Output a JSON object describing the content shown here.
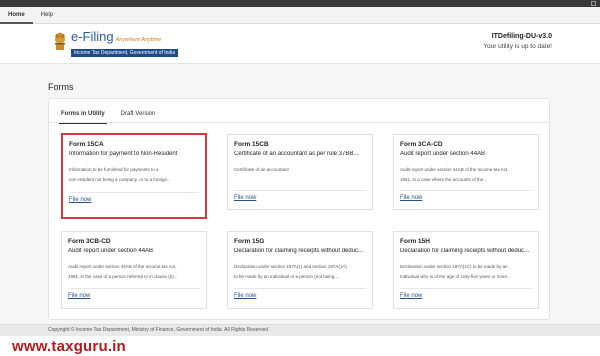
{
  "menu": {
    "items": [
      "Home",
      "Help"
    ]
  },
  "header": {
    "brand": "e-Filing",
    "tagline": "Anywhere Anytime",
    "department": "Income Tax Department, Government of India",
    "version": "ITDefiling-DU-v3.0",
    "status": "Your utility is up to date!"
  },
  "page": {
    "title": "Forms"
  },
  "tabs": [
    "Forms in Utility",
    "Draft Version"
  ],
  "cards": [
    {
      "title": "Form 15CA",
      "subtitle": "Information for payment to Non-Resident",
      "desc1": "Information to be furnished for payments to a",
      "desc2": "non-resident not being a company, or to a foreign...",
      "link": "File now"
    },
    {
      "title": "Form 15CB",
      "subtitle": "Certificate of an accountant as per rule 37BB...",
      "desc1": "Certificate of an accountant",
      "desc2": "",
      "link": "File now"
    },
    {
      "title": "Form 3CA-CD",
      "subtitle": "Audit report under section 44AB",
      "desc1": "Audit report under section 44AB of the Income-tax Act,",
      "desc2": "1961, in a case where the accounts of the...",
      "link": "File now"
    },
    {
      "title": "Form 3CB-CD",
      "subtitle": "Audit report under section 44AB",
      "desc1": "Audit report under section 44AB of the Income-tax Act,",
      "desc2": "1961, in the case of a person referred to in clause (b)...",
      "link": "File now"
    },
    {
      "title": "Form 15G",
      "subtitle": "Declaration for claiming receipts without deduc...",
      "desc1": "Declaration under section 197A(1) and section 197A(1A)",
      "desc2": "to be made by an Individual or a person (not being...",
      "link": "File now"
    },
    {
      "title": "Form 15H",
      "subtitle": "Declaration for claiming receipts without deduc...",
      "desc1": "Declaration under section 197A(1C) to be made by an",
      "desc2": "Individual who is of the age of sixty-five years or more...",
      "link": "File now"
    }
  ],
  "footer": {
    "text": "Copyright © Income Tax Department, Ministry of Finance, Government of India. All Rights Reserved"
  },
  "watermark": "www.taxguru.in"
}
